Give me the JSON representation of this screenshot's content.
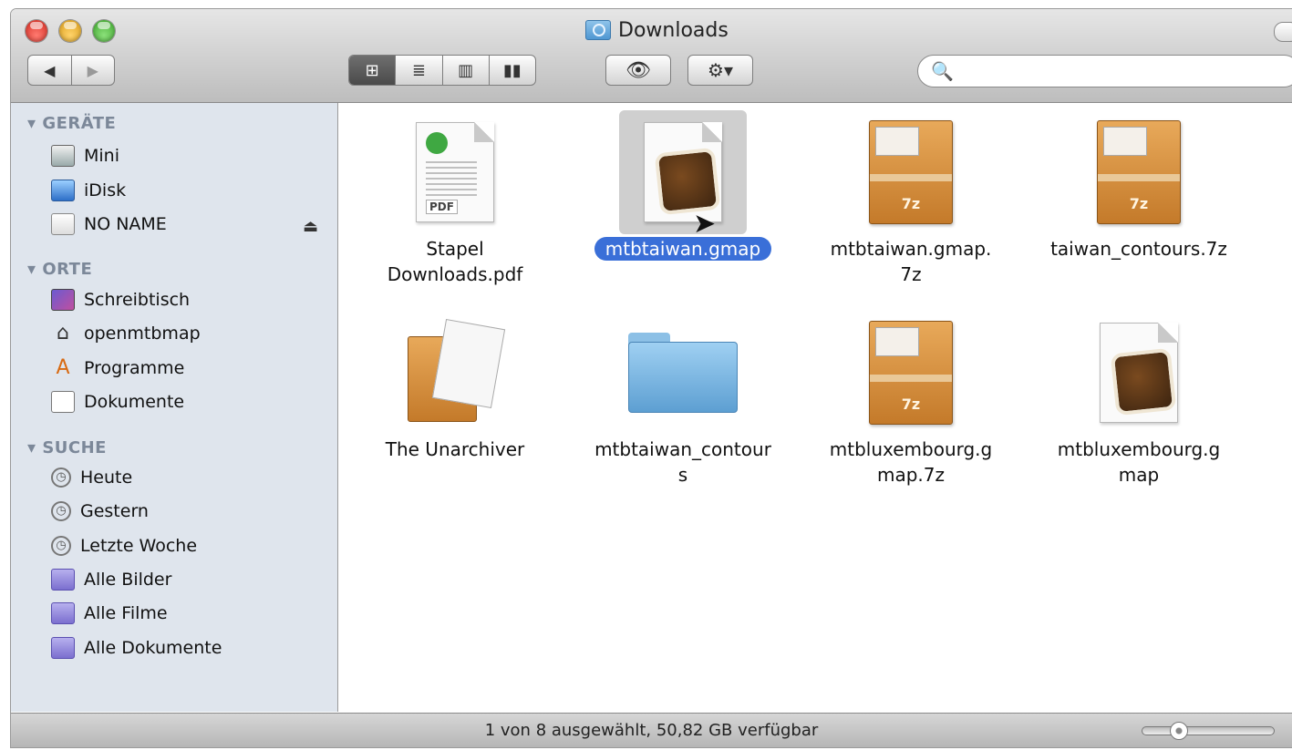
{
  "window": {
    "title": "Downloads"
  },
  "toolbar": {
    "back_glyph": "◀",
    "forward_glyph": "▶",
    "view_modes": [
      "icon-view",
      "list-view",
      "column-view",
      "cover-flow"
    ],
    "view_glyphs": [
      "⊞",
      "≣",
      "▥",
      "▮▮"
    ],
    "quicklook_glyph": "👁",
    "action_glyph": "⚙▾",
    "search_glyph": "🔍",
    "search_value": ""
  },
  "sidebar": {
    "sections": {
      "devices": "GERÄTE",
      "places": "ORTE",
      "search": "SUCHE"
    },
    "devices": [
      "Mini",
      "iDisk",
      "NO NAME"
    ],
    "places": [
      "Schreibtisch",
      "openmtbmap",
      "Programme",
      "Dokumente"
    ],
    "searches": [
      "Heute",
      "Gestern",
      "Letzte Woche",
      "Alle Bilder",
      "Alle Filme",
      "Alle Dokumente"
    ],
    "eject_glyph": "⏏"
  },
  "files": [
    {
      "name": "Stapel Downloads.pdf",
      "type": "pdf",
      "selected": false
    },
    {
      "name": "mtbtaiwan.gmap",
      "type": "gmap",
      "selected": true
    },
    {
      "name": "mtbtaiwan.gmap.7z",
      "type": "7z",
      "selected": false
    },
    {
      "name": "taiwan_contours.7z",
      "type": "7z",
      "selected": false
    },
    {
      "name": "The Unarchiver",
      "type": "app",
      "selected": false
    },
    {
      "name": "mtbtaiwan_contours",
      "type": "folder",
      "selected": false
    },
    {
      "name": "mtbluxembourg.gmap.7z",
      "type": "7z",
      "selected": false
    },
    {
      "name": "mtbluxembourg.gmap",
      "type": "gmap",
      "selected": false
    }
  ],
  "labels": {
    "file0_l1": "Stapel",
    "file0_l2": "Downloads.pdf",
    "file1": "mtbtaiwan.gmap",
    "file2_l1": "mtbtaiwan.gmap.",
    "file2_l2": "7z",
    "file3": "taiwan_contours.7z",
    "file4": "The Unarchiver",
    "file5_l1": "mtbtaiwan_contour",
    "file5_l2": "s",
    "file6_l1": "mtbluxembourg.g",
    "file6_l2": "map.7z",
    "file7_l1": "mtbluxembourg.g",
    "file7_l2": "map",
    "pdf_tag": "PDF",
    "badge_7z": "7z"
  },
  "status": {
    "text": "1 von 8 ausgewählt, 50,82 GB verfügbar",
    "icon_size_fraction": 0.25
  }
}
